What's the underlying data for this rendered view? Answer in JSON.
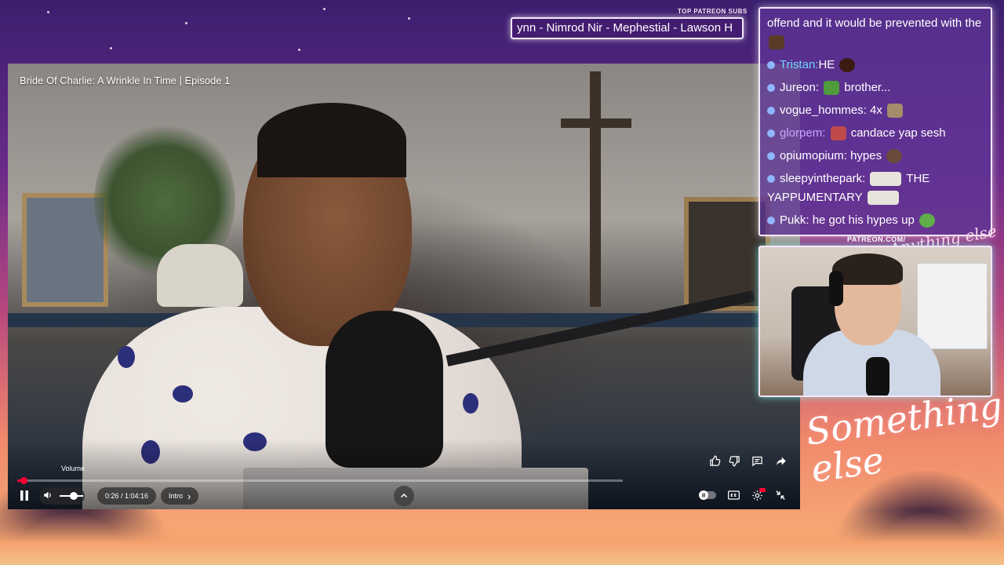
{
  "overlay": {
    "patreon_label": "TOP PATREON SUBS",
    "ticker_text": "ynn - Nimrod Nir - Mephestial - Lawson H",
    "webcam_header": "PATREON.COM/",
    "webcam_script": "Anything else",
    "brand_text": "Something else"
  },
  "player": {
    "title": "Bride Of Charlie: A Wrinkle In Time | Episode 1",
    "volume_tooltip": "Volume",
    "time": "0:26 / 1:04:16",
    "chapter": "Intro",
    "chapter_arrow": "›",
    "progress_fraction": 0.011,
    "volume_fraction": 0.6,
    "accent_color": "#ff0033"
  },
  "chat": {
    "lines": [
      {
        "user": "",
        "text": "offend and it would be prevented with the"
      },
      {
        "user": "Tristan:",
        "text": "HE"
      },
      {
        "user": "Jureon:",
        "text": "brother..."
      },
      {
        "user": "vogue_hommes:",
        "text": "4x"
      },
      {
        "user": "glorpem:",
        "text": "candace yap sesh"
      },
      {
        "user": "opiumopium:",
        "text": "hypes"
      },
      {
        "user": "sleepyinthepark:",
        "text": "THE YAPPUMENTARY"
      },
      {
        "user": "Pukk:",
        "text": "he got his hypes up"
      }
    ]
  }
}
